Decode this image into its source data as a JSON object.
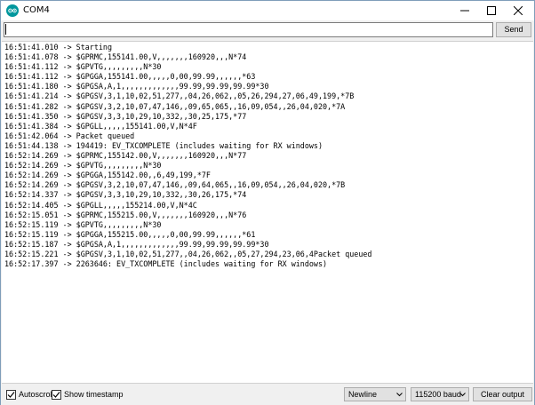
{
  "window": {
    "title": "COM4",
    "app_icon": "arduino-icon",
    "controls": [
      "minimize-icon",
      "maximize-icon",
      "close-icon"
    ]
  },
  "send": {
    "input_value": "",
    "button_label": "Send"
  },
  "output": {
    "lines": [
      "16:51:41.010 -> Starting",
      "16:51:41.078 -> $GPRMC,155141.00,V,,,,,,,160920,,,N*74",
      "16:51:41.112 -> $GPVTG,,,,,,,,,N*30",
      "16:51:41.112 -> $GPGGA,155141.00,,,,,0,00,99.99,,,,,,*63",
      "16:51:41.180 -> $GPGSA,A,1,,,,,,,,,,,,,99.99,99.99,99.99*30",
      "16:51:41.214 -> $GPGSV,3,1,10,02,51,277,,04,26,062,,05,26,294,27,06,49,199,*7B",
      "16:51:41.282 -> $GPGSV,3,2,10,07,47,146,,09,65,065,,16,09,054,,26,04,020,*7A",
      "16:51:41.350 -> $GPGSV,3,3,10,29,10,332,,30,25,175,*77",
      "16:51:41.384 -> $GPGLL,,,,,155141.00,V,N*4F",
      "16:51:42.064 -> Packet queued",
      "16:51:44.138 -> 194419: EV_TXCOMPLETE (includes waiting for RX windows)",
      "16:52:14.269 -> $GPRMC,155142.00,V,,,,,,,160920,,,N*77",
      "16:52:14.269 -> $GPVTG,,,,,,,,,N*30",
      "16:52:14.269 -> $GPGGA,155142.00,,6,49,199,*7F",
      "16:52:14.269 -> $GPGSV,3,2,10,07,47,146,,09,64,065,,16,09,054,,26,04,020,*7B",
      "16:52:14.337 -> $GPGSV,3,3,10,29,10,332,,30,26,175,*74",
      "16:52:14.405 -> $GPGLL,,,,,155214.00,V,N*4C",
      "16:52:15.051 -> $GPRMC,155215.00,V,,,,,,,160920,,,N*76",
      "16:52:15.119 -> $GPVTG,,,,,,,,,N*30",
      "16:52:15.119 -> $GPGGA,155215.00,,,,,0,00,99.99,,,,,,*61",
      "16:52:15.187 -> $GPGSA,A,1,,,,,,,,,,,,,99.99,99.99,99.99*30",
      "16:52:15.221 -> $GPGSV,3,1,10,02,51,277,,04,26,062,,05,27,294,23,06,4Packet queued",
      "16:52:17.397 -> 2263646: EV_TXCOMPLETE (includes waiting for RX windows)"
    ]
  },
  "bottom": {
    "autoscroll": {
      "label": "Autoscroll",
      "checked": true
    },
    "show_timestamp": {
      "label": "Show timestamp",
      "checked": true
    },
    "line_ending": "Newline",
    "baud": "115200 baud",
    "clear_label": "Clear output"
  },
  "colors": {
    "brand": "#00979d",
    "window_bg": "#f0f0f0",
    "button_bg": "#e1e1e1"
  }
}
